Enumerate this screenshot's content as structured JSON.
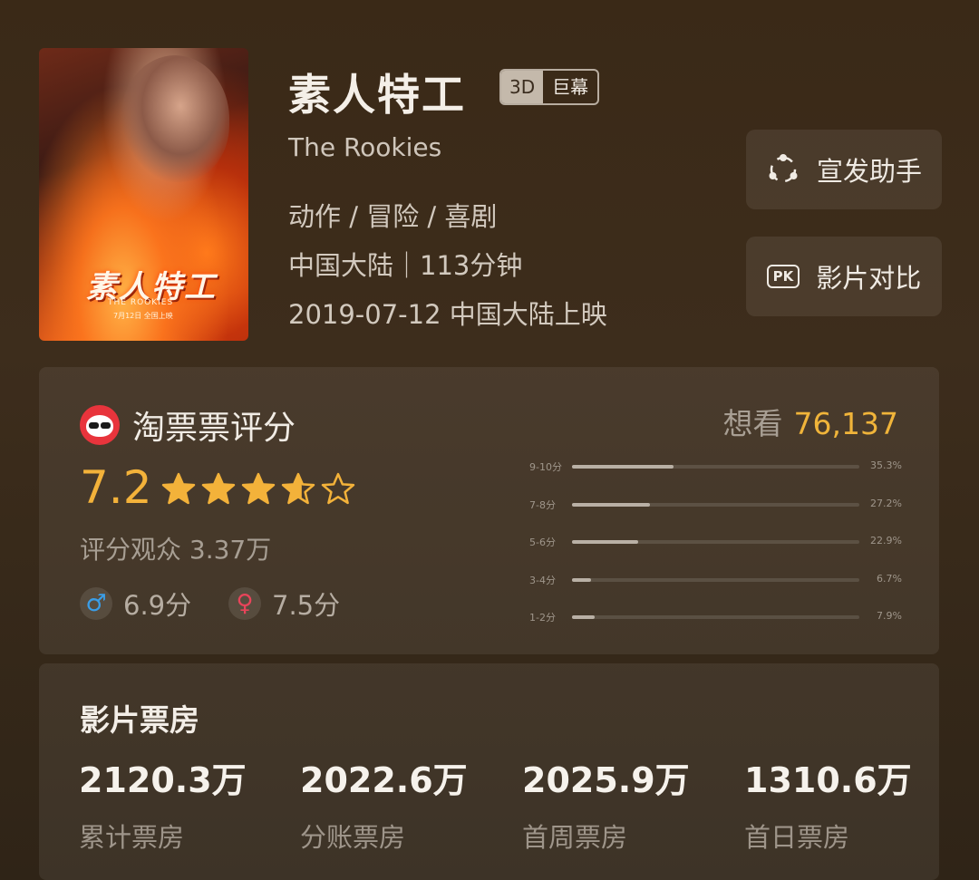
{
  "movie": {
    "title": "素人特工",
    "badge_3d": "3D",
    "badge_format": "巨幕",
    "english_title": "The Rookies",
    "genres": "动作 / 冒险 / 喜剧",
    "region_runtime": "中国大陆｜113分钟",
    "release": "2019-07-12 中国大陆上映",
    "poster": {
      "title": "素人特工",
      "subtitle": "THE ROOKIES",
      "date": "7月12日 全国上映"
    }
  },
  "actions": {
    "promo_label": "宣发助手",
    "compare_label": "影片对比",
    "compare_icon_text": "PK"
  },
  "rating": {
    "title": "淘票票评分",
    "want_label": "想看",
    "want_count": "76,137",
    "score": "7.2",
    "stars": 3.6,
    "raters": "评分观众 3.37万",
    "male_icon": "♂",
    "male_score": "6.9分",
    "female_icon": "♀",
    "female_score": "7.5分",
    "distribution": [
      {
        "label": "9-10分",
        "percent": "35.3%",
        "value": 35.3
      },
      {
        "label": "7-8分",
        "percent": "27.2%",
        "value": 27.2
      },
      {
        "label": "5-6分",
        "percent": "22.9%",
        "value": 22.9
      },
      {
        "label": "3-4分",
        "percent": "6.7%",
        "value": 6.7
      },
      {
        "label": "1-2分",
        "percent": "7.9%",
        "value": 7.9
      }
    ]
  },
  "box_office": {
    "title": "影片票房",
    "items": [
      {
        "value": "2120.3万",
        "label": "累计票房"
      },
      {
        "value": "2022.6万",
        "label": "分账票房"
      },
      {
        "value": "2025.9万",
        "label": "首周票房"
      },
      {
        "value": "1310.6万",
        "label": "首日票房"
      }
    ]
  },
  "colors": {
    "accent": "#f3b23a",
    "male": "#3a9ee8",
    "female": "#e8445a",
    "logo": "#e8343c"
  }
}
